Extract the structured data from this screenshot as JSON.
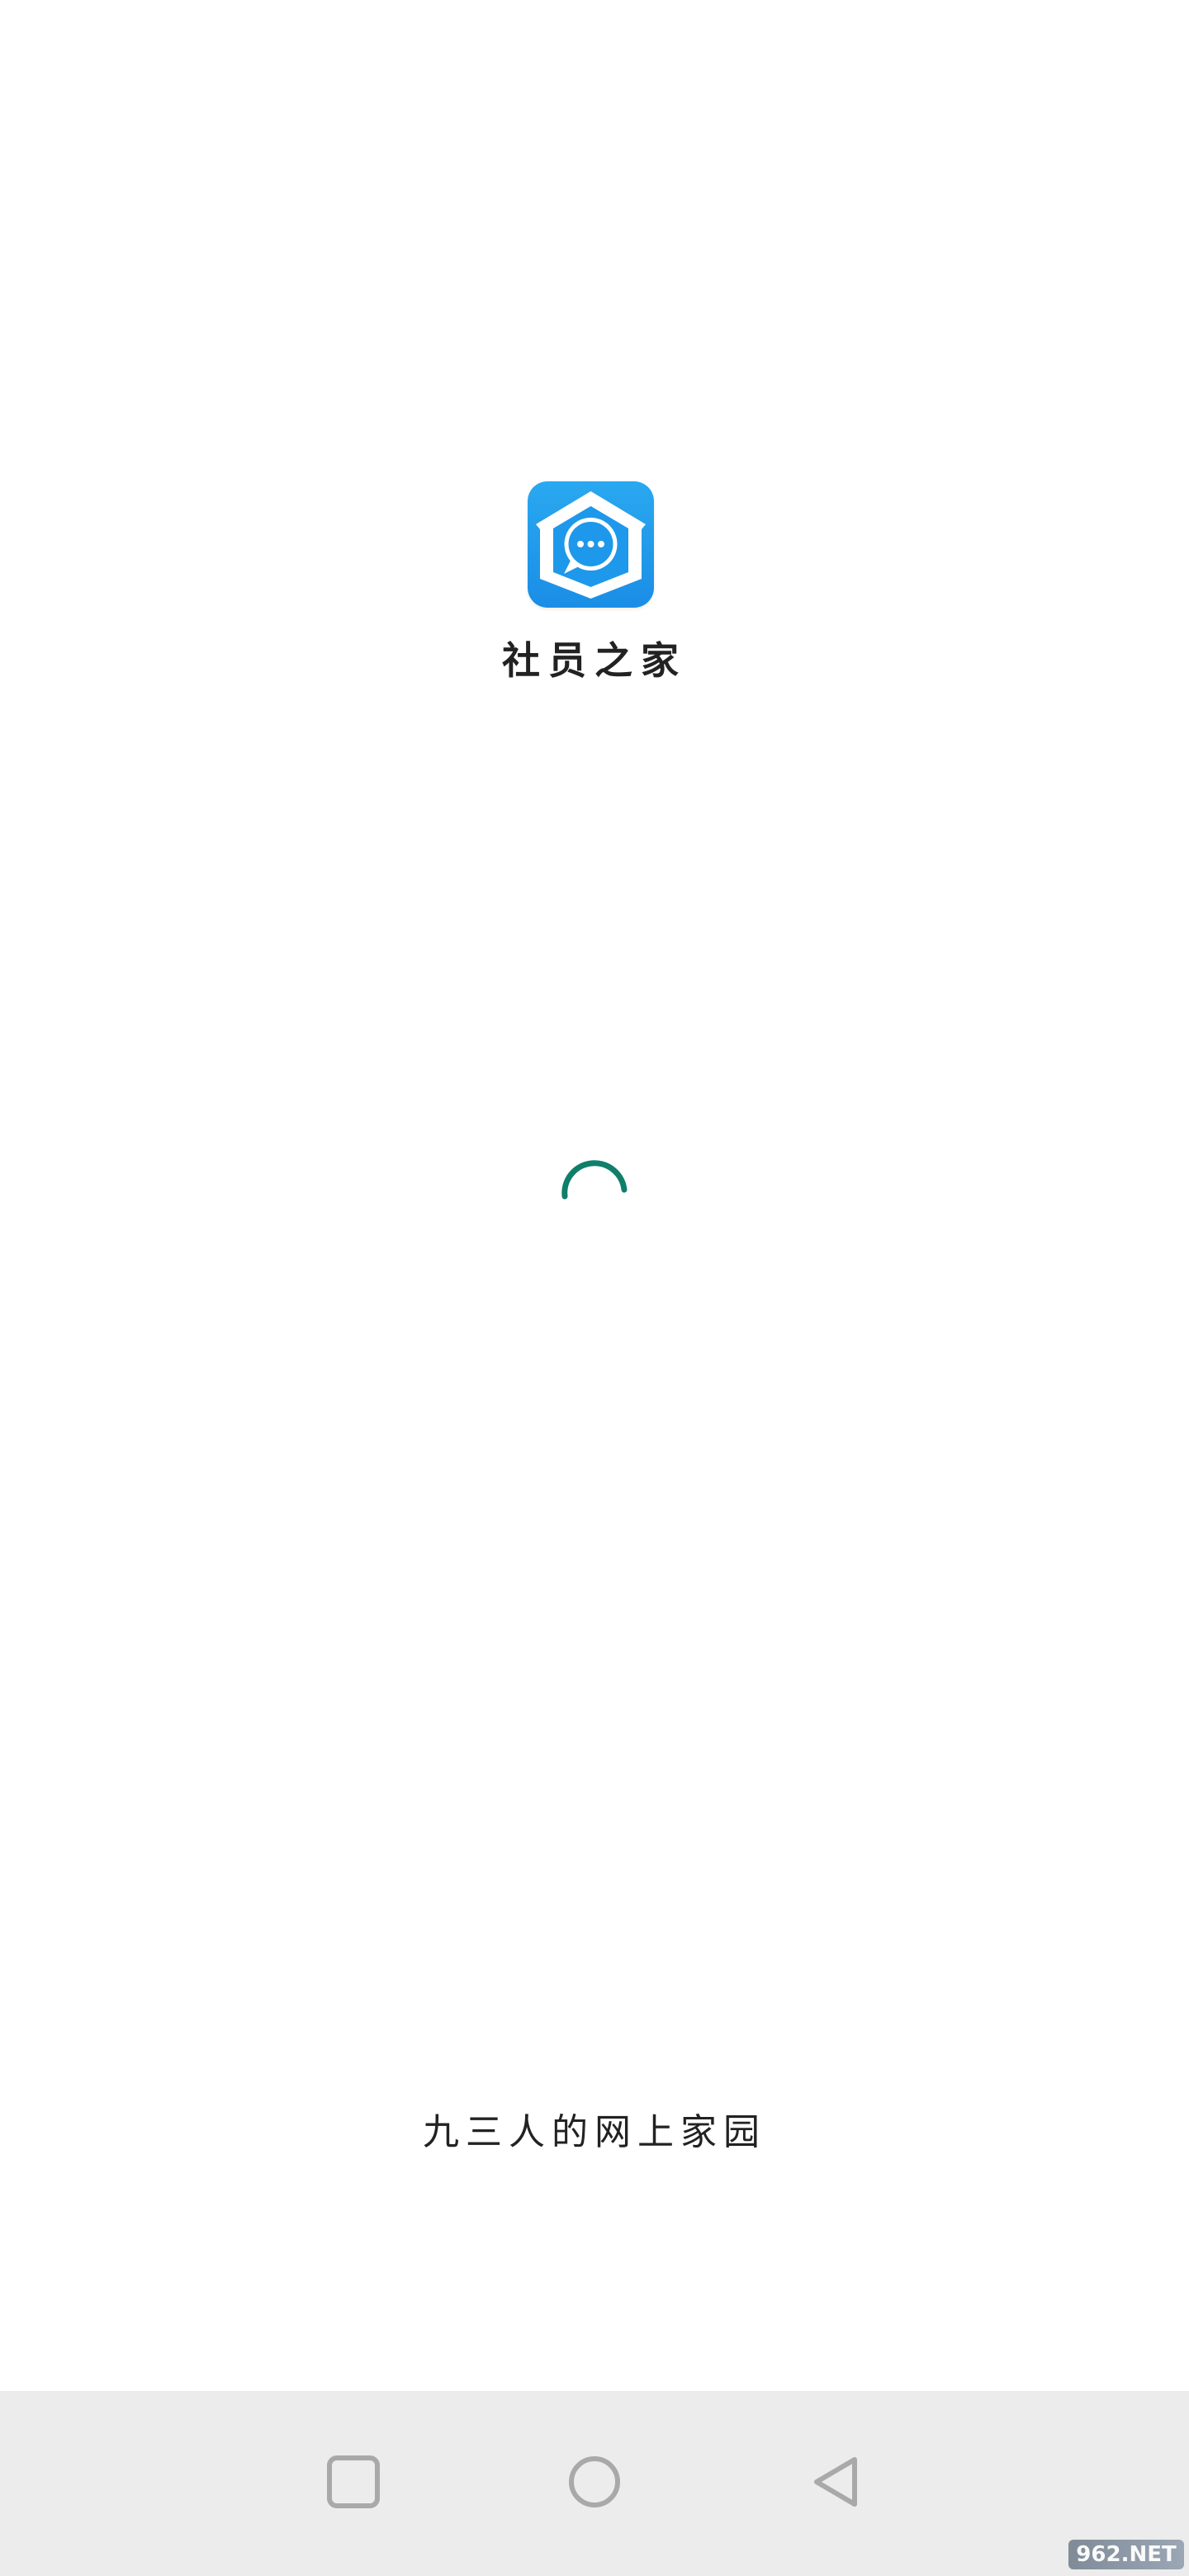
{
  "splash": {
    "app_name": "社员之家",
    "slogan": "九三人的网上家园",
    "logo_icon": "house-chat-bubble-icon",
    "spinner_color": "#0f7f6b",
    "logo_color": "#1a8ee6"
  },
  "nav_bar": {
    "recents_icon": "square-icon",
    "home_icon": "circle-icon",
    "back_icon": "triangle-back-icon"
  },
  "watermark": {
    "text": "962.NET"
  }
}
